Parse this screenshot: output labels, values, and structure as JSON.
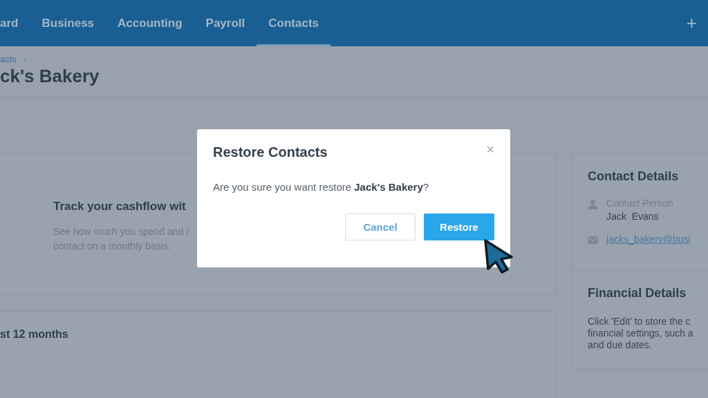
{
  "nav": {
    "tabs": [
      {
        "label": "ard",
        "selected": false
      },
      {
        "label": "Business",
        "selected": false
      },
      {
        "label": "Accounting",
        "selected": false
      },
      {
        "label": "Payroll",
        "selected": false
      },
      {
        "label": "Contacts",
        "selected": true
      }
    ],
    "add_button": "+"
  },
  "breadcrumb": {
    "link": "acts",
    "separator": "›"
  },
  "page_title": "ck's Bakery",
  "cashflow_card": {
    "heading": "Track your cashflow wit",
    "body": [
      "See how much you spend and r",
      "contact on a monthly basis."
    ]
  },
  "history_card": {
    "heading": "st 12 months"
  },
  "contact_details": {
    "heading": "Contact Details",
    "person_label": "Contact Person",
    "person_name": "Jack  Evans",
    "email": "jacks_bakery@busi"
  },
  "financial_details": {
    "heading": "Financial Details",
    "body": [
      "Click 'Edit' to store the c",
      "financial settings, such a",
      "and due dates."
    ]
  },
  "dialog": {
    "title": "Restore Contacts",
    "close": "×",
    "message": "Are you sure you want restore **Jack's Bakery**?",
    "buttons": [
      {
        "label": "Cancel",
        "kind": "secondary"
      },
      {
        "label": "Restore",
        "kind": "primary"
      }
    ]
  }
}
